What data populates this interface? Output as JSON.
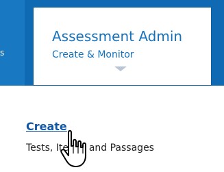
{
  "nav": {
    "left_tab_fragment": "s",
    "active_tab": {
      "title": "Assessment Admin",
      "subtitle": "Create & Monitor",
      "icon": "chevron-down-icon"
    }
  },
  "content": {
    "create_link_label": "Create",
    "create_description": "Tests, Items, and Passages"
  },
  "cursor": {
    "icon": "hand-pointer-icon"
  },
  "colors": {
    "nav_bg": "#0f6ab3",
    "tab_text": "#1572bb",
    "link": "#1156a5"
  }
}
